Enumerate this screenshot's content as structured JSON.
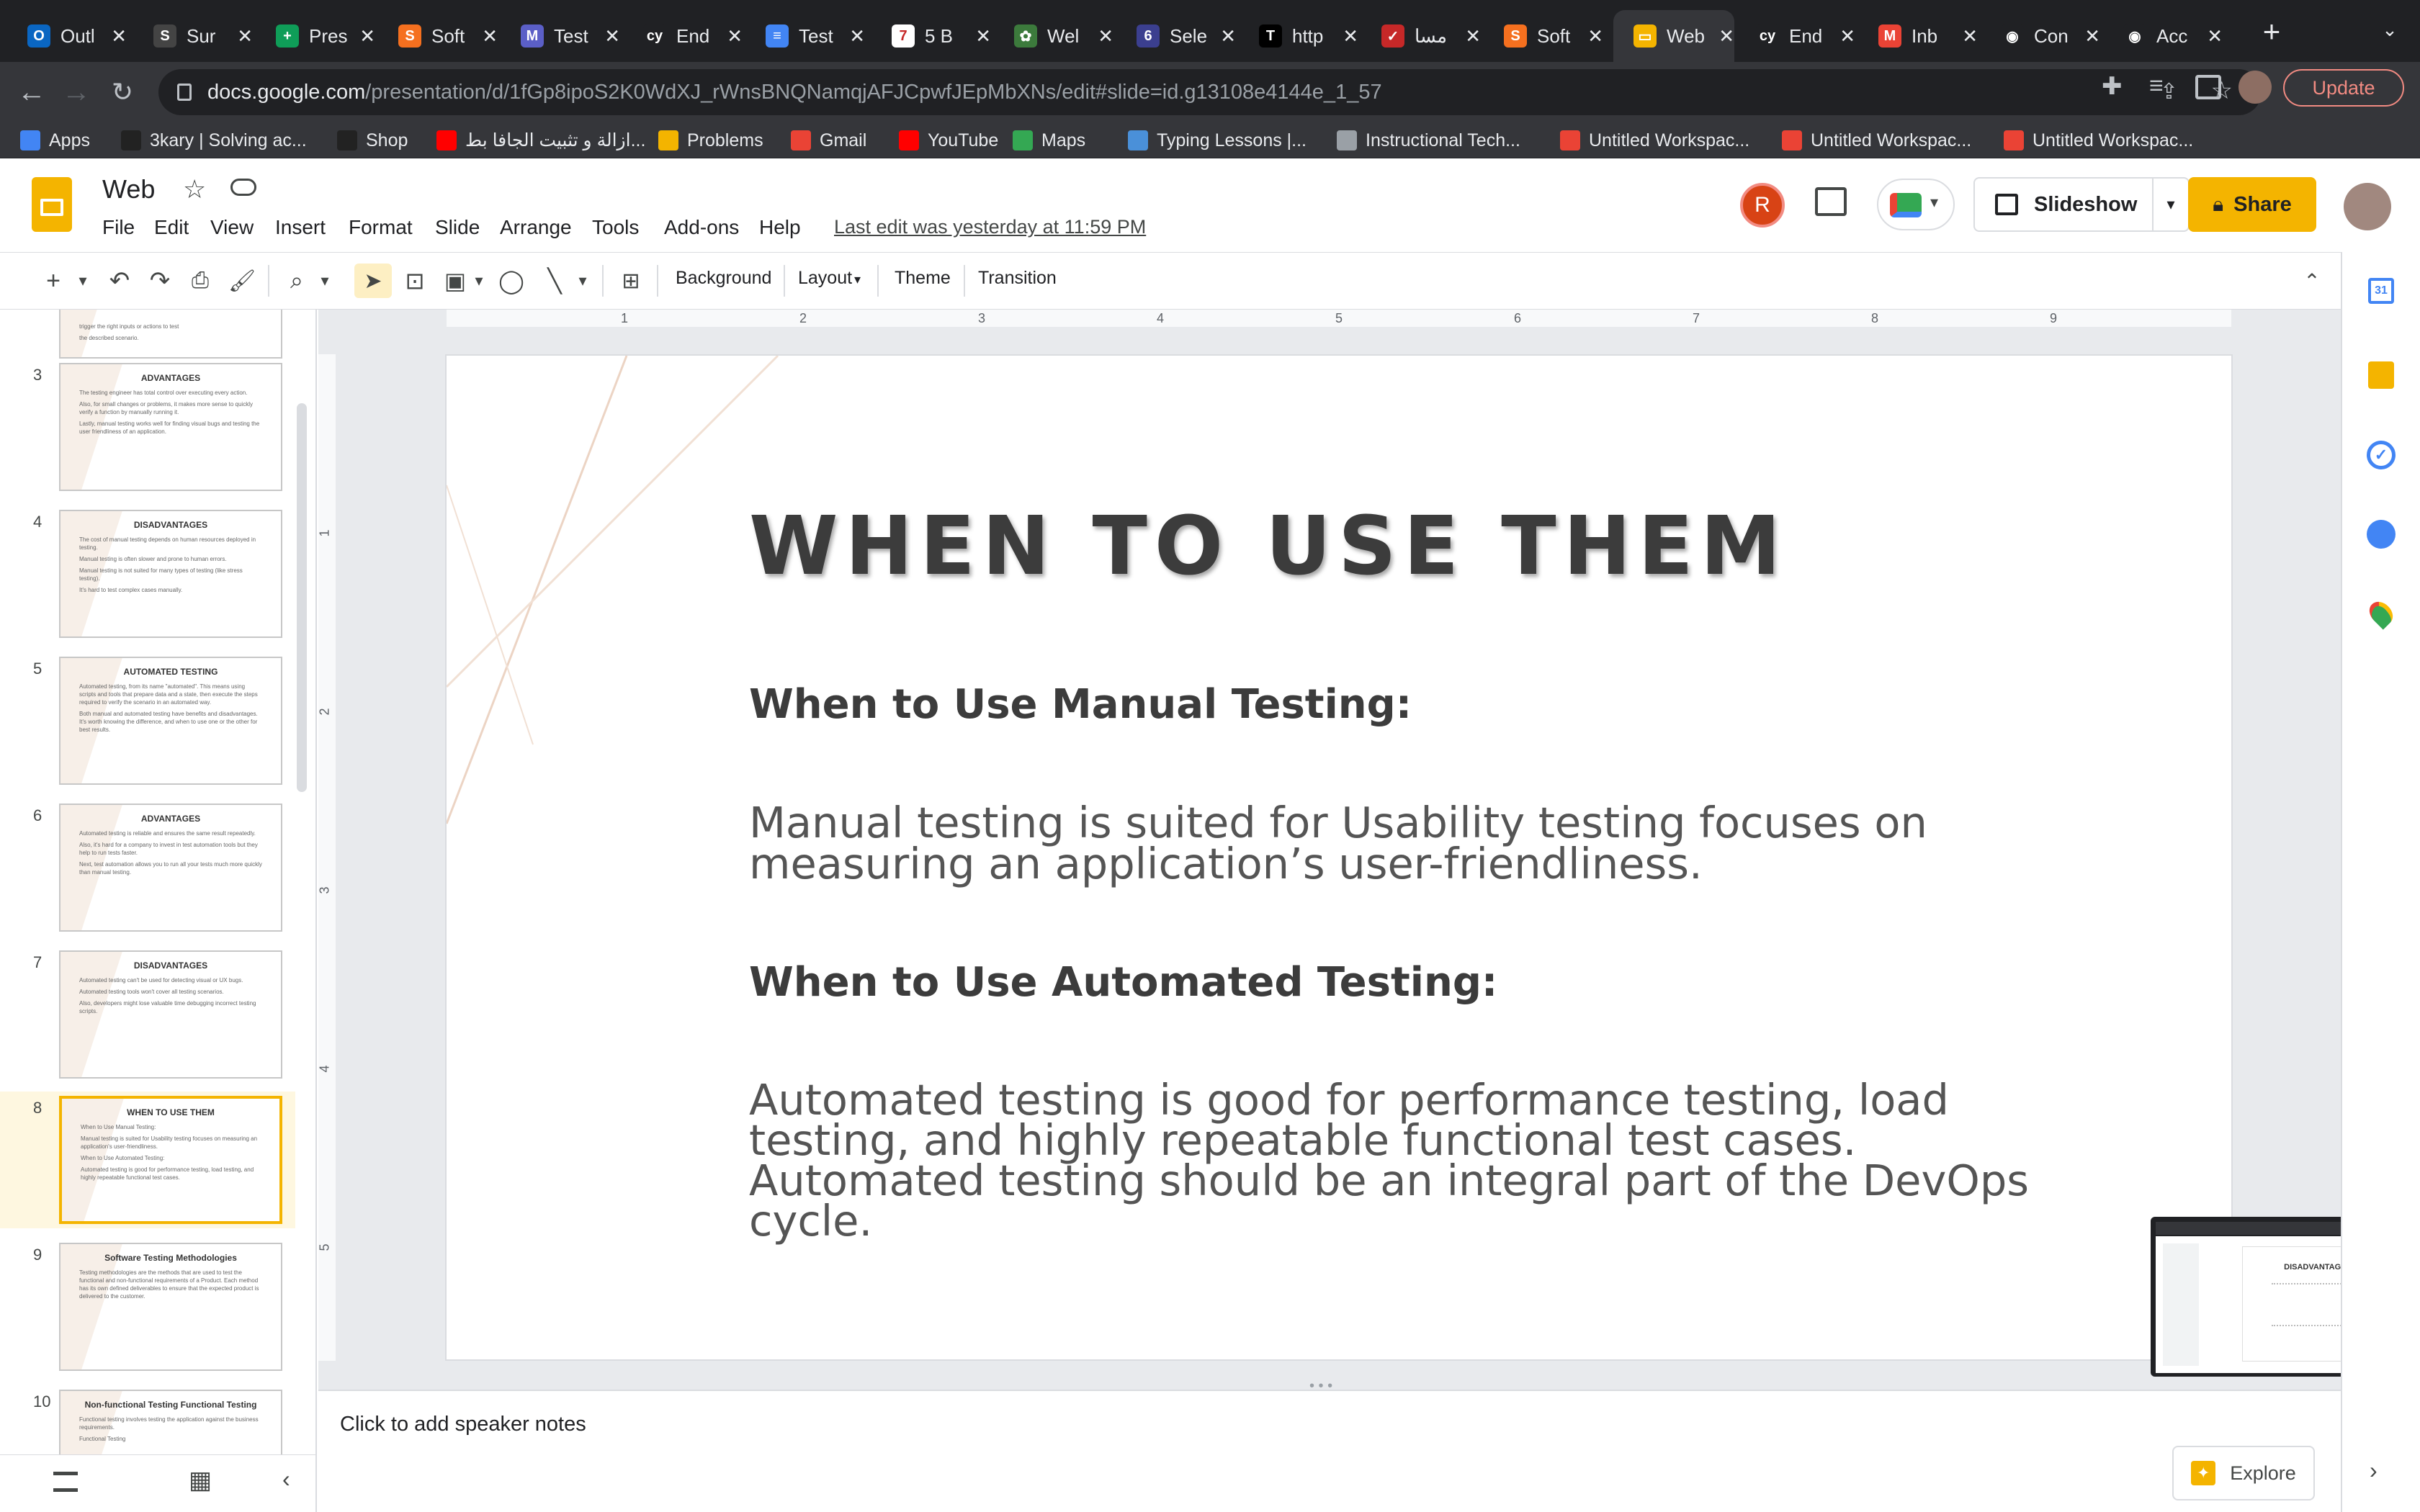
{
  "browser": {
    "tabs": [
      {
        "title": "Outl",
        "fav": "O",
        "color": "#0a66c2"
      },
      {
        "title": "Sur",
        "fav": "S",
        "color": "#444444"
      },
      {
        "title": "Pres",
        "fav": "+",
        "color": "#0f9d58"
      },
      {
        "title": "Soft",
        "fav": "S",
        "color": "#f5701f"
      },
      {
        "title": "Test",
        "fav": "M",
        "color": "#5b5fc7"
      },
      {
        "title": "End",
        "fav": "cy",
        "color": "#202124"
      },
      {
        "title": "Test",
        "fav": "≡",
        "color": "#4285f4"
      },
      {
        "title": "5 B",
        "fav": "7",
        "color": "#ffffff"
      },
      {
        "title": "Wel",
        "fav": "✿",
        "color": "#3c7a3c"
      },
      {
        "title": "Sele",
        "fav": "6",
        "color": "#3b3f8f"
      },
      {
        "title": "http",
        "fav": "T",
        "color": "#000000"
      },
      {
        "title": "مسا",
        "fav": "✓",
        "color": "#c62828"
      },
      {
        "title": "Soft",
        "fav": "S",
        "color": "#f5701f"
      },
      {
        "title": "Web",
        "fav": "▭",
        "color": "#f4b400"
      },
      {
        "title": "End",
        "fav": "cy",
        "color": "#202124"
      },
      {
        "title": "Inb",
        "fav": "M",
        "color": "#ea4335"
      },
      {
        "title": "Con",
        "fav": "◉",
        "color": "#202124"
      },
      {
        "title": "Acc",
        "fav": "◉",
        "color": "#202124"
      }
    ],
    "active_tab": 13,
    "url_domain": "docs.google.com",
    "url_path": "/presentation/d/1fGp8ipoS2K0WdXJ_rWnsBNQNamqjAFJCpwfJEpMbXNs/edit#slide=id.g13108e4144e_1_57",
    "update_label": "Update",
    "bookmarks": [
      {
        "label": "Apps",
        "icon": "apps-grid-icon",
        "color": "#4285f4"
      },
      {
        "label": "3kary | Solving ac...",
        "icon": "wix-icon",
        "color": "#222"
      },
      {
        "label": "Shop",
        "icon": "wix-icon",
        "color": "#222"
      },
      {
        "label": "ازالة و تثبيت الجافا بط...",
        "icon": "youtube-icon",
        "color": "#ff0000"
      },
      {
        "label": "Problems",
        "icon": "codeforces-icon",
        "color": "#f4b400"
      },
      {
        "label": "Gmail",
        "icon": "gmail-icon",
        "color": "#ea4335"
      },
      {
        "label": "YouTube",
        "icon": "youtube-icon",
        "color": "#ff0000"
      },
      {
        "label": "Maps",
        "icon": "maps-icon",
        "color": "#34a853"
      },
      {
        "label": "Typing Lessons |...",
        "icon": "typing-icon",
        "color": "#4a90d9"
      },
      {
        "label": "Instructional Tech...",
        "icon": "globe-icon",
        "color": "#9aa0a6"
      },
      {
        "label": "Untitled Workspac...",
        "icon": "workspace-icon",
        "color": "#ea4335"
      },
      {
        "label": "Untitled Workspac...",
        "icon": "workspace-icon",
        "color": "#ea4335"
      },
      {
        "label": "Untitled Workspac...",
        "icon": "workspace-icon",
        "color": "#ea4335"
      }
    ]
  },
  "doc": {
    "title": "Web",
    "menus": [
      "File",
      "Edit",
      "View",
      "Insert",
      "Format",
      "Slide",
      "Arrange",
      "Tools",
      "Add-ons",
      "Help"
    ],
    "last_edit": "Last edit was yesterday at 11:59 PM",
    "avatar_letter": "R",
    "slideshow_label": "Slideshow",
    "share_label": "Share"
  },
  "toolbar": {
    "background": "Background",
    "layout": "Layout",
    "theme": "Theme",
    "transition": "Transition"
  },
  "ruler": {
    "h": [
      "1",
      "2",
      "3",
      "4",
      "5",
      "6",
      "7",
      "8",
      "9"
    ],
    "v": [
      "1",
      "2",
      "3",
      "4",
      "5"
    ]
  },
  "filmstrip": [
    {
      "num": "",
      "title": "",
      "lines": [
        "trigger the right inputs or actions to test",
        "the described scenario."
      ]
    },
    {
      "num": "3",
      "title": "ADVANTAGES",
      "lines": [
        "The testing engineer has total control over executing every action.",
        "Also, for small changes or problems, it makes more sense to quickly verify a function by manually running it.",
        "Lastly, manual testing works well for finding visual bugs and testing the user friendliness of an application."
      ]
    },
    {
      "num": "4",
      "title": "DISADVANTAGES",
      "lines": [
        "The cost of manual testing depends on human resources deployed in testing.",
        "Manual testing is often slower and prone to human errors.",
        "Manual testing is not suited for many types of testing (like stress testing).",
        "It's hard to test complex cases manually."
      ]
    },
    {
      "num": "5",
      "title": "AUTOMATED TESTING",
      "lines": [
        "Automated testing, from its name \"automated\". This means using scripts and tools that prepare data and a state, then execute the steps required to verify the scenario in an automated way.",
        "Both manual and automated testing have benefits and disadvantages. It's worth knowing the difference, and when to use one or the other for best results."
      ]
    },
    {
      "num": "6",
      "title": "ADVANTAGES",
      "lines": [
        "Automated testing is reliable and ensures the same result repeatedly.",
        "Also, it's hard for a company to invest in test automation tools but they help to run tests faster.",
        "Next, test automation allows you to run all your tests much more quickly than manual testing."
      ]
    },
    {
      "num": "7",
      "title": "DISADVANTAGES",
      "lines": [
        "Automated testing can't be used for detecting visual or UX bugs.",
        "Automated testing tools won't cover all testing scenarios.",
        "Also, developers might lose valuable time debugging incorrect testing scripts."
      ]
    },
    {
      "num": "8",
      "title": "WHEN TO USE THEM",
      "lines": [
        "When to Use Manual Testing:",
        "Manual testing is suited for Usability testing focuses on measuring an application's user-friendliness.",
        "When to Use Automated Testing:",
        "Automated testing is good for performance testing, load testing, and highly repeatable functional test cases."
      ]
    },
    {
      "num": "9",
      "title": "Software Testing Methodologies",
      "lines": [
        "Testing methodologies are the methods that are used to test the functional and non-functional requirements of a Product. Each method has its own defined deliverables to ensure that the expected product is delivered to the customer."
      ]
    },
    {
      "num": "10",
      "title": "Non-functional Testing      Functional Testing",
      "lines": [
        "Functional testing involves testing the application against the business requirements.",
        "Functional Testing"
      ]
    }
  ],
  "slide": {
    "title": "WHEN TO USE THEM",
    "h1": "When to Use Manual Testing:",
    "p1": "Manual testing is suited for Usability testing focuses on measuring an application’s user-friendliness.",
    "h2": "When to Use Automated Testing:",
    "p2": "Automated testing is good for performance testing, load testing, and highly repeatable functional test cases. Automated testing should be an integral part of the DevOps cycle."
  },
  "notes": {
    "placeholder": "Click to add speaker notes"
  },
  "pip": {
    "title": "DISADVANTAGES"
  },
  "explore": {
    "label": "Explore"
  },
  "colors": {
    "accent": "#f4b400",
    "tabbar": "#202124",
    "chrome": "#35363a",
    "update": "#f28b82"
  }
}
